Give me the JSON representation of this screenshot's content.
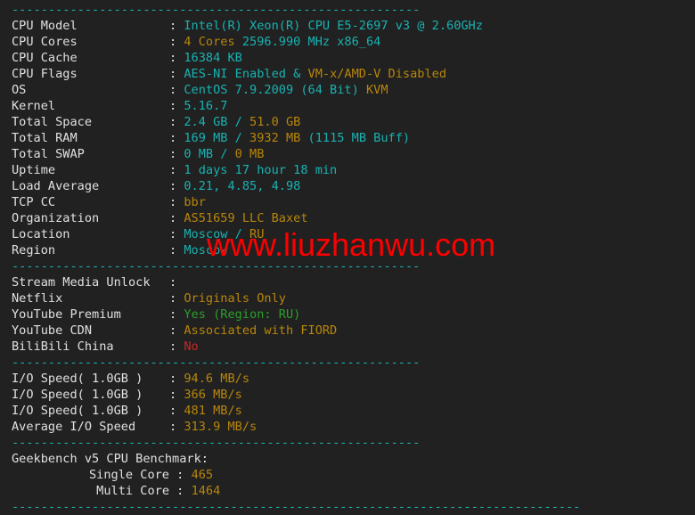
{
  "terminal": {
    "background_color": "#212121",
    "label_color": "#e0e0e0",
    "cyan": "#19b2b2",
    "yellow": "#b8860b",
    "green": "#2aa02a",
    "red": "#c62828",
    "separator": "--------------------------------------------------------",
    "separator_short": "------------------------------------------------------------------------------"
  },
  "watermark": {
    "text": "www.liuzhanwu.com",
    "color": "#fe0000"
  },
  "system": {
    "rows": [
      {
        "label": "CPU Model",
        "value_cyan": "Intel(R) Xeon(R) CPU E5-2697 v3 @ 2.60GHz",
        "value_yellow": ""
      },
      {
        "label": "CPU Cores",
        "value_yellow": "4 Cores",
        "value_cyan": " 2596.990 MHz x86_64"
      },
      {
        "label": "CPU Cache",
        "value_cyan": "16384 KB",
        "value_yellow": ""
      },
      {
        "label": "CPU Flags",
        "value_cyan": "AES-NI Enabled & ",
        "value_yellow": "VM-x/AMD-V Disabled"
      },
      {
        "label": "OS",
        "value_cyan": "CentOS 7.9.2009 (64 Bit) ",
        "value_yellow": "KVM"
      },
      {
        "label": "Kernel",
        "value_cyan": "5.16.7",
        "value_yellow": ""
      },
      {
        "label": "Total Space",
        "value_cyan": "2.4 GB / ",
        "value_yellow": "51.0 GB"
      },
      {
        "label": "Total RAM",
        "value_cyan": "169 MB / ",
        "value_yellow": "3932 MB",
        "value_cyan2": " (1115 MB Buff)"
      },
      {
        "label": "Total SWAP",
        "value_cyan": "0 MB / ",
        "value_yellow": "0 MB"
      },
      {
        "label": "Uptime",
        "value_cyan": "1 days 17 hour 18 min",
        "value_yellow": ""
      },
      {
        "label": "Load Average",
        "value_cyan": "0.21, 4.85, 4.98",
        "value_yellow": ""
      },
      {
        "label": "TCP CC",
        "value_yellow": "bbr",
        "value_cyan": ""
      },
      {
        "label": "Organization",
        "value_yellow": "AS51659 LLC Baxet",
        "value_cyan": ""
      },
      {
        "label": "Location",
        "value_cyan": "Moscow / ",
        "value_yellow": "RU"
      },
      {
        "label": "Region",
        "value_cyan": "Moscow",
        "value_yellow": ""
      }
    ]
  },
  "stream_media": {
    "heading_label": "Stream Media Unlock",
    "heading_value": "",
    "rows": [
      {
        "label": "Netflix",
        "value": "Originals Only",
        "color": "yellow"
      },
      {
        "label": "YouTube Premium",
        "value": "Yes (Region: RU)",
        "color": "green"
      },
      {
        "label": "YouTube CDN",
        "value": "Associated with FIORD",
        "color": "yellow"
      },
      {
        "label": "BiliBili China",
        "value": "No",
        "color": "red"
      }
    ]
  },
  "io_speed": {
    "rows": [
      {
        "label": "I/O Speed( 1.0GB )",
        "value": "94.6 MB/s"
      },
      {
        "label": "I/O Speed( 1.0GB )",
        "value": "366 MB/s"
      },
      {
        "label": "I/O Speed( 1.0GB )",
        "value": "481 MB/s"
      },
      {
        "label": "Average I/O Speed",
        "value": "313.9 MB/s"
      }
    ]
  },
  "geekbench": {
    "heading": "Geekbench v5 CPU Benchmark:",
    "rows": [
      {
        "label": "Single Core",
        "value": "465"
      },
      {
        "label": "Multi Core",
        "value": "1464"
      }
    ]
  }
}
